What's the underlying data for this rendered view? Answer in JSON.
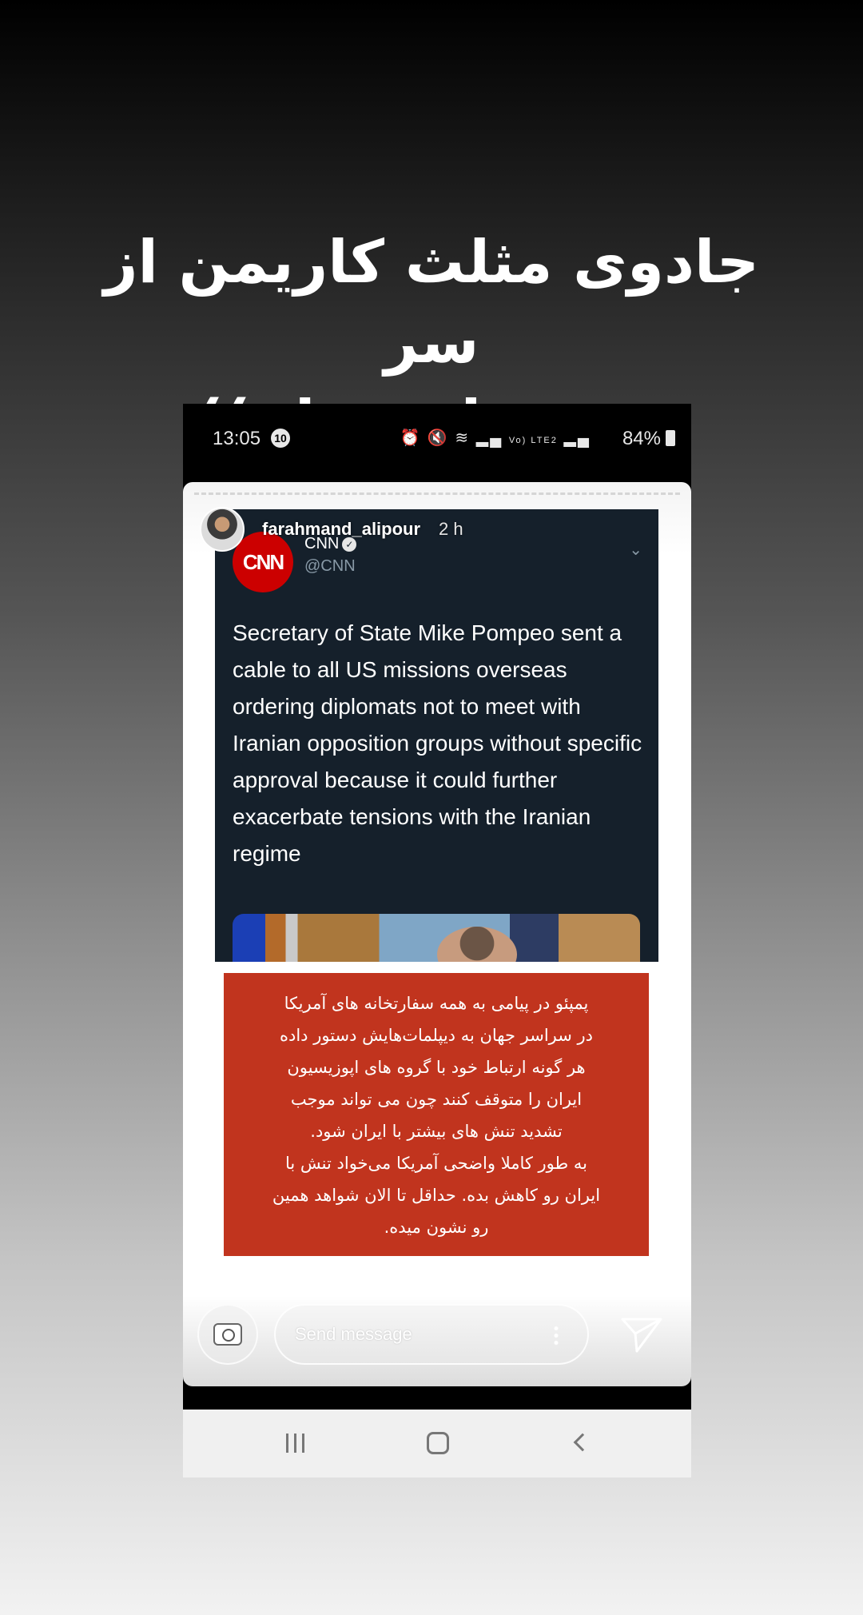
{
  "caption": {
    "line1": "جادوی مثلث کاریمن از سر",
    "line2": "تیزش اینه ها :))"
  },
  "status_bar": {
    "time": "13:05",
    "notification_count": "10",
    "network": "Vo) LTE2",
    "battery": "84%"
  },
  "story": {
    "username": "farahmand_alipour",
    "time_ago": "2 h"
  },
  "tweet": {
    "logo_text": "CNN",
    "account_name": "CNN",
    "handle": "@CNN",
    "text": "Secretary of State Mike Pompeo sent a cable to all US missions overseas ordering diplomats not to meet with Iranian opposition groups without specific approval because it could further exacerbate tensions with the Iranian regime"
  },
  "persian_text": {
    "lines": [
      "پمپئو در پیامی به همه سفارتخانه های آمریکا",
      "در سراسر جهان به دیپلمات‌هایش دستور داده",
      "هر گونه ارتباط خود با گروه های اپوزیسیون",
      "ایران را متوقف کنند چون می تواند موجب",
      "تشدید تنش های بیشتر با ایران شود.",
      "به طور کاملا واضحی آمریکا می‌خواد تنش با",
      "ایران رو کاهش بده. حداقل تا الان شواهد همین",
      "رو نشون میده."
    ]
  },
  "reply": {
    "placeholder": "Send message"
  },
  "colors": {
    "tweet_bg": "#15202b",
    "cnn_red": "#cc0000",
    "persian_box_bg": "#c1341e"
  },
  "icons": {
    "camera": "camera-icon",
    "send": "paper-plane-icon",
    "nav_recent": "recent-apps-icon",
    "nav_home": "home-icon",
    "nav_back": "back-icon"
  }
}
